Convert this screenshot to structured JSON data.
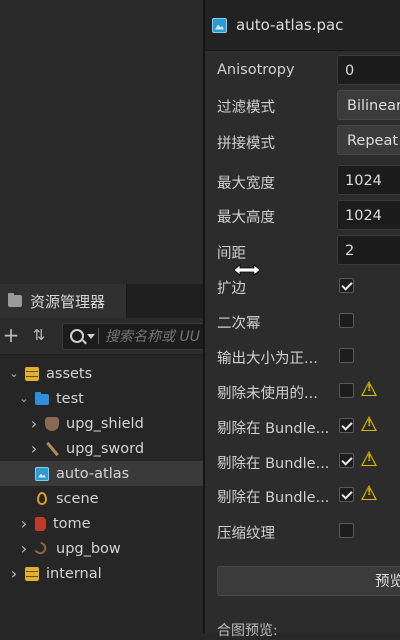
{
  "inspector": {
    "title": "auto-atlas.pac",
    "properties": [
      {
        "label": "Anisotropy",
        "kind": "number",
        "value": "0"
      },
      {
        "label": "过滤模式",
        "kind": "select",
        "value": "Bilinear"
      },
      {
        "label": "拼接模式",
        "kind": "select",
        "value": "Repeat"
      },
      {
        "label": "最大宽度",
        "kind": "number",
        "value": "1024"
      },
      {
        "label": "最大高度",
        "kind": "number",
        "value": "1024"
      },
      {
        "label": "间距",
        "kind": "number",
        "value": "2"
      },
      {
        "label": "扩边",
        "kind": "checkbox",
        "checked": true
      },
      {
        "label": "二次幂",
        "kind": "checkbox",
        "checked": false
      },
      {
        "label": "输出大小为正...",
        "kind": "checkbox",
        "checked": false
      },
      {
        "label": "剔除未使用的...",
        "kind": "checkbox",
        "checked": false,
        "warning": true
      },
      {
        "label": "剔除在 Bundle...",
        "kind": "checkbox",
        "checked": true,
        "warning": true
      },
      {
        "label": "剔除在 Bundle...",
        "kind": "checkbox",
        "checked": true,
        "warning": true
      },
      {
        "label": "剔除在 Bundle...",
        "kind": "checkbox",
        "checked": true,
        "warning": true
      },
      {
        "label": "压缩纹理",
        "kind": "checkbox",
        "checked": false
      }
    ],
    "preview_button": "预览",
    "bottom_label": "合图预览:"
  },
  "assets": {
    "tab_label": "资源管理器",
    "search_placeholder": "搜索名称或 UU",
    "tree": [
      {
        "label": "assets",
        "icon": "database-icon",
        "depth": 0,
        "expanded": true
      },
      {
        "label": "test",
        "icon": "folder-icon",
        "depth": 1,
        "expanded": true
      },
      {
        "label": "upg_shield",
        "icon": "shield-icon",
        "depth": 2,
        "expanded": false
      },
      {
        "label": "upg_sword",
        "icon": "sword-icon",
        "depth": 2,
        "expanded": false
      },
      {
        "label": "auto-atlas",
        "icon": "atlas-icon",
        "depth": 1,
        "leaf": true,
        "selected": true
      },
      {
        "label": "scene",
        "icon": "scene-icon",
        "depth": 1,
        "leaf": true
      },
      {
        "label": "tome",
        "icon": "tome-icon",
        "depth": 1,
        "expanded": false
      },
      {
        "label": "upg_bow",
        "icon": "bow-icon",
        "depth": 1,
        "expanded": false
      },
      {
        "label": "internal",
        "icon": "database-icon",
        "depth": 0,
        "expanded": false
      }
    ]
  },
  "colors": {
    "background": "#272727",
    "selection": "#3a3a3a",
    "warning": "#d9b400",
    "folder": "#2d8fe0"
  }
}
